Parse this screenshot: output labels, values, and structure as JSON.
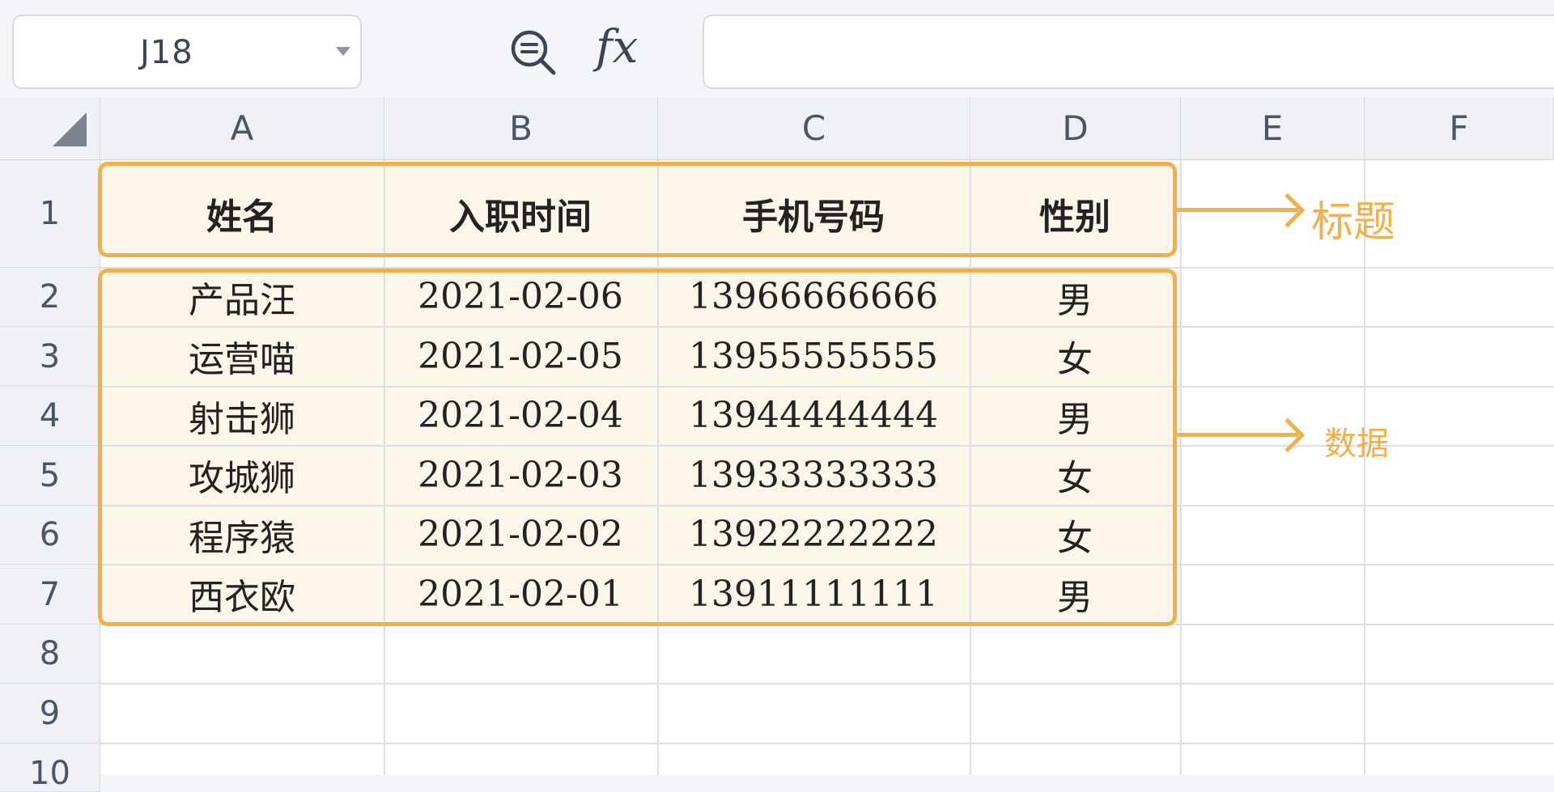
{
  "toolbar": {
    "name_box": "J18",
    "fx_label": "fx",
    "formula": ""
  },
  "sheet": {
    "columns": [
      "A",
      "B",
      "C",
      "D",
      "E",
      "F"
    ],
    "rows": [
      "1",
      "2",
      "3",
      "4",
      "5",
      "6",
      "7",
      "8",
      "9",
      "10"
    ],
    "header": [
      "姓名",
      "入职时间",
      "手机号码",
      "性别"
    ],
    "data": [
      [
        "产品汪",
        "2021-02-06",
        "13966666666",
        "男"
      ],
      [
        "运营喵",
        "2021-02-05",
        "13955555555",
        "女"
      ],
      [
        "射击狮",
        "2021-02-04",
        "13944444444",
        "男"
      ],
      [
        "攻城狮",
        "2021-02-03",
        "13933333333",
        "女"
      ],
      [
        "程序猿",
        "2021-02-02",
        "13922222222",
        "女"
      ],
      [
        "西衣欧",
        "2021-02-01",
        "13911111111",
        "男"
      ]
    ]
  },
  "annotations": {
    "title_label": "标题",
    "data_label": "数据",
    "accent_color": "#f2b04c"
  },
  "icons": {
    "zoom": "zoom-out-icon",
    "corner": "select-all-icon",
    "dropdown": "chevron-down-icon"
  }
}
